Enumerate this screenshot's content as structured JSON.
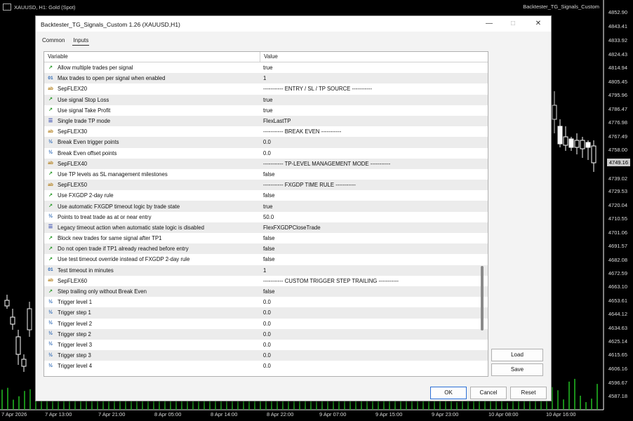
{
  "chart": {
    "symbol_title": "XAUUSD, H1:  Gold (Spot)",
    "ea_name": "Backtester_TG_Signals_Custom",
    "current_price": "4749.16",
    "price_labels": [
      "4852.90",
      "4843.41",
      "4833.92",
      "4824.43",
      "4814.94",
      "4805.45",
      "4795.96",
      "4786.47",
      "4776.98",
      "4767.49",
      "4758.00",
      "4739.02",
      "4729.53",
      "4720.04",
      "4710.55",
      "4701.06",
      "4691.57",
      "4682.08",
      "4672.59",
      "4663.10",
      "4653.61",
      "4644.12",
      "4634.63",
      "4625.14",
      "4615.65",
      "4606.16",
      "4596.67",
      "4587.18"
    ],
    "time_labels": [
      "7 Apr 2026",
      "7 Apr 13:00",
      "7 Apr 21:00",
      "8 Apr 05:00",
      "8 Apr 14:00",
      "8 Apr 22:00",
      "9 Apr 07:00",
      "9 Apr 15:00",
      "9 Apr 23:00",
      "10 Apr 08:00",
      "10 Apr 16:00"
    ]
  },
  "dialog": {
    "title": "Backtester_TG_Signals_Custom 1.26 (XAUUSD,H1)",
    "tabs": [
      {
        "label": "Common"
      },
      {
        "label": "Inputs"
      }
    ],
    "columns": {
      "variable": "Variable",
      "value": "Value"
    },
    "rows": [
      {
        "type": "bool",
        "variable": "Allow multiple trades per signal",
        "value": "true"
      },
      {
        "type": "int",
        "variable": "Max trades to open per signal when enabled",
        "value": "1"
      },
      {
        "type": "str",
        "variable": "SepFLEX20",
        "value": "----------- ENTRY / SL / TP SOURCE -----------"
      },
      {
        "type": "bool",
        "variable": "Use signal Stop Loss",
        "value": "true"
      },
      {
        "type": "bool",
        "variable": "Use signal Take Profit",
        "value": "true"
      },
      {
        "type": "enum",
        "variable": "Single trade TP mode",
        "value": "FlexLastTP"
      },
      {
        "type": "str",
        "variable": "SepFLEX30",
        "value": "----------- BREAK EVEN -----------"
      },
      {
        "type": "dbl",
        "variable": "Break Even trigger points",
        "value": "0.0"
      },
      {
        "type": "dbl",
        "variable": "Break Even offset points",
        "value": "0.0"
      },
      {
        "type": "str",
        "variable": "SepFLEX40",
        "value": "----------- TP-LEVEL MANAGEMENT MODE -----------"
      },
      {
        "type": "bool",
        "variable": "Use TP levels as SL management milestones",
        "value": "false"
      },
      {
        "type": "str",
        "variable": "SepFLEX50",
        "value": "----------- FXGDP TIME RULE -----------"
      },
      {
        "type": "bool",
        "variable": "Use FXGDP 2-day rule",
        "value": "false"
      },
      {
        "type": "bool",
        "variable": "Use automatic FXGDP timeout logic by trade state",
        "value": "true"
      },
      {
        "type": "dbl",
        "variable": "Points to treat trade as at or near entry",
        "value": "50.0"
      },
      {
        "type": "enum",
        "variable": "Legacy timeout action when automatic state logic is disabled",
        "value": "FlexFXGDPCloseTrade"
      },
      {
        "type": "bool",
        "variable": "Block new trades for same signal after TP1",
        "value": "false"
      },
      {
        "type": "bool",
        "variable": "Do not open trade if TP1 already reached before entry",
        "value": "false"
      },
      {
        "type": "bool",
        "variable": "Use test timeout override instead of FXGDP 2-day rule",
        "value": "false"
      },
      {
        "type": "int",
        "variable": "Test timeout in minutes",
        "value": "1"
      },
      {
        "type": "str",
        "variable": "SepFLEX60",
        "value": "----------- CUSTOM TRIGGER STEP TRAILING -----------"
      },
      {
        "type": "bool",
        "variable": "Step trailing only without Break Even",
        "value": "false"
      },
      {
        "type": "dbl",
        "variable": "Trigger level 1",
        "value": "0.0"
      },
      {
        "type": "dbl",
        "variable": "Trigger step 1",
        "value": "0.0"
      },
      {
        "type": "dbl",
        "variable": "Trigger level 2",
        "value": "0.0"
      },
      {
        "type": "dbl",
        "variable": "Trigger step 2",
        "value": "0.0"
      },
      {
        "type": "dbl",
        "variable": "Trigger level 3",
        "value": "0.0"
      },
      {
        "type": "dbl",
        "variable": "Trigger step 3",
        "value": "0.0"
      },
      {
        "type": "dbl",
        "variable": "Trigger level 4",
        "value": "0.0"
      }
    ],
    "buttons": {
      "load": "Load",
      "save": "Save",
      "ok": "OK",
      "cancel": "Cancel",
      "reset": "Reset"
    }
  }
}
